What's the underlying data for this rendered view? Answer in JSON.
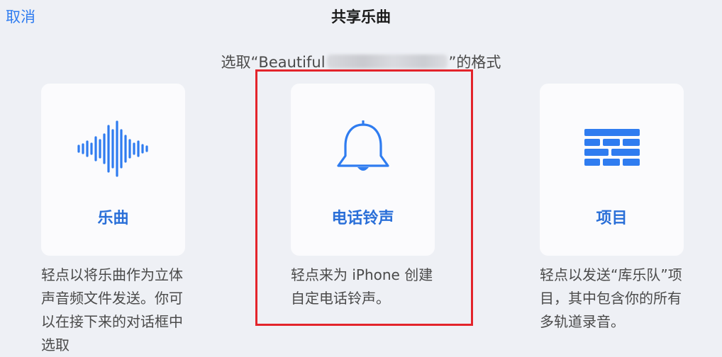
{
  "header": {
    "cancel_label": "取消",
    "title": "共享乐曲"
  },
  "subtitle": {
    "prefix": "选取“Beautiful",
    "suffix": "”的格式"
  },
  "options": [
    {
      "label": "乐曲",
      "icon": "waveform-icon",
      "description": "轻点以将乐曲作为立体声音频文件发送。你可以在接下来的对话框中选取"
    },
    {
      "label": "电话铃声",
      "icon": "bell-icon",
      "description": "轻点来为 iPhone 创建自定电话铃声。"
    },
    {
      "label": "项目",
      "icon": "brick-wall-icon",
      "description": "轻点以发送“库乐队”项目，其中包含你的所有多轨道录音。"
    }
  ],
  "colors": {
    "accent": "#2f7cf0",
    "highlight_border": "#e3242b",
    "background": "#eef0f5",
    "card": "#fbfbfd"
  }
}
